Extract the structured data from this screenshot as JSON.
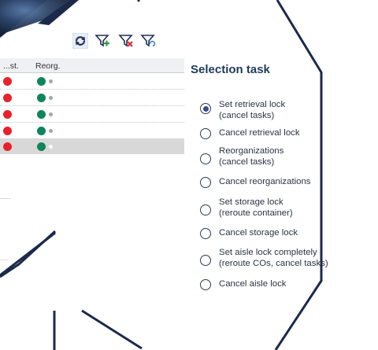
{
  "toolbar": {
    "icons": [
      "refresh-icon",
      "filter-add-icon",
      "filter-remove-icon",
      "filter-reset-icon"
    ]
  },
  "table": {
    "headers": [
      "...st.",
      "Reorg."
    ],
    "rows": [
      {
        "status": "red",
        "reorg": "green"
      },
      {
        "status": "red",
        "reorg": "green"
      },
      {
        "status": "red",
        "reorg": "green"
      },
      {
        "status": "red",
        "reorg": "green"
      },
      {
        "status": "red",
        "reorg": "green",
        "selected": true
      }
    ]
  },
  "colors": {
    "navy": "#1b2a4a",
    "red": "#e8212b",
    "green": "#10845a",
    "filter_green": "#2e9e48",
    "filter_red": "#d9262c",
    "filter_blue": "#3f86c8"
  },
  "selection": {
    "title": "Selection task",
    "options": [
      {
        "label": "Set retrieval lock\n(cancel tasks)",
        "checked": true
      },
      {
        "label": "Cancel retrieval lock",
        "checked": false
      },
      {
        "label": "Reorganizations\n(cancel tasks)",
        "checked": false
      },
      {
        "label": "Cancel reorganizations",
        "checked": false
      },
      {
        "label": "Set storage lock\n(reroute container)",
        "checked": false
      },
      {
        "label": "Cancel storage lock",
        "checked": false
      },
      {
        "label": "Set aisle lock completely\n(reroute COs, cancel tasks)",
        "checked": false
      },
      {
        "label": "Cancel aisle lock",
        "checked": false
      }
    ]
  }
}
